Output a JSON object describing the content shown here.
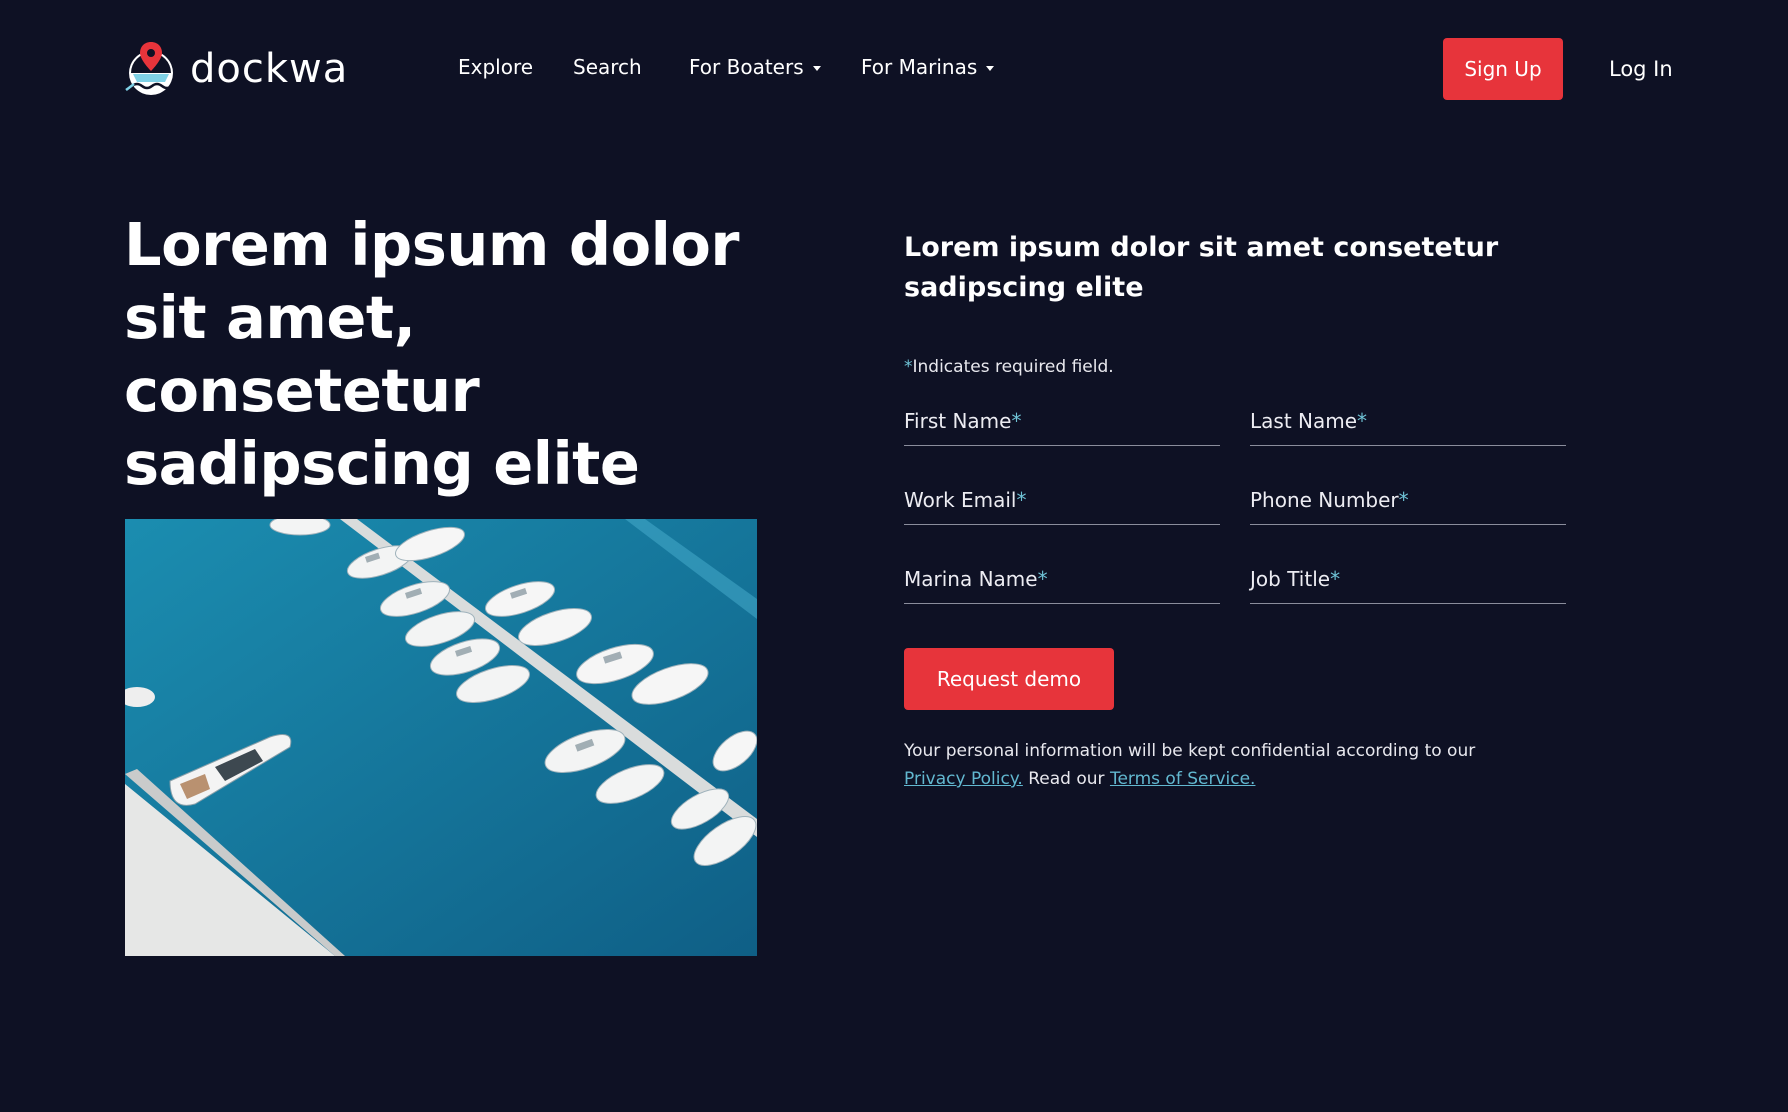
{
  "brand": {
    "name": "dockwa",
    "accent": "#e7343b",
    "background": "#0e1124",
    "link_color": "#62b8d0"
  },
  "nav": {
    "links": [
      {
        "label": "Explore"
      },
      {
        "label": "Search"
      },
      {
        "label": "For Boaters",
        "has_dropdown": true
      },
      {
        "label": "For Marinas",
        "has_dropdown": true
      }
    ],
    "signup_label": "Sign Up",
    "login_label": "Log In"
  },
  "hero": {
    "title": "Lorem ipsum dolor sit amet, consetetur sadipscing elite",
    "image_icon": "marina-boats-aerial-photo"
  },
  "form": {
    "heading": "Lorem ipsum dolor sit amet consetetur sadipscing elite",
    "required_marker": "*",
    "required_note": "Indicates required field.",
    "fields": [
      {
        "label": "First Name"
      },
      {
        "label": "Last Name"
      },
      {
        "label": "Work Email"
      },
      {
        "label": "Phone Number"
      },
      {
        "label": "Marina Name"
      },
      {
        "label": "Job Title"
      }
    ],
    "submit_label": "Request demo",
    "privacy_text": "Your personal information will be kept confidential according to our",
    "privacy_link": "Privacy Policy.",
    "read_text": "Read our",
    "terms_link": "Terms of Service."
  }
}
